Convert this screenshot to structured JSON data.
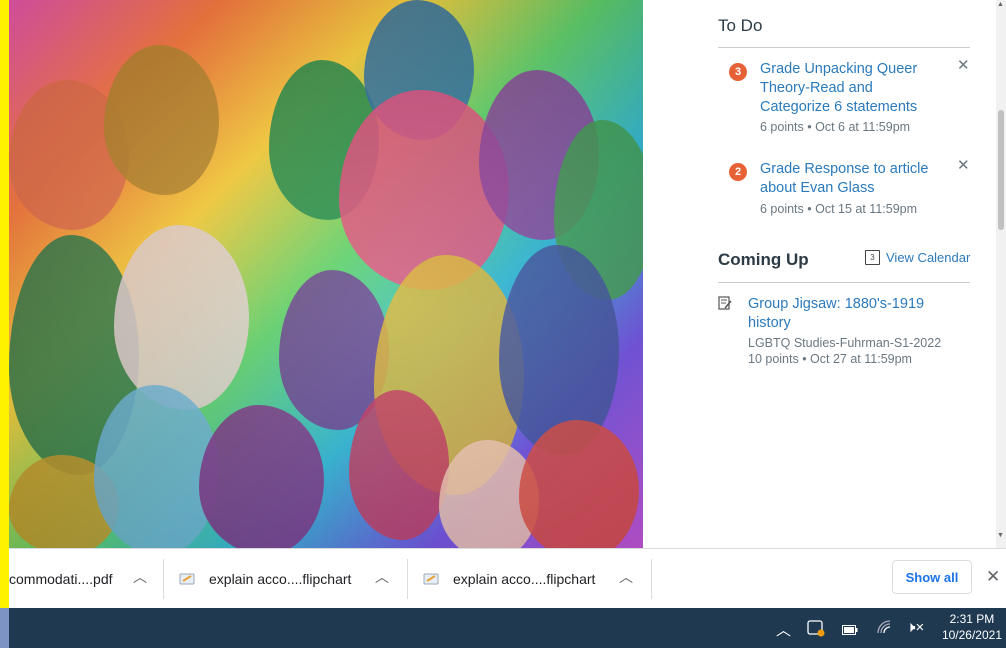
{
  "todo": {
    "heading": "To Do",
    "items": [
      {
        "badge": "3",
        "title_line1": "Grade Unpacking Queer",
        "title_line2": "Theory-Read and",
        "title_line3": "Categorize 6 statements",
        "meta": "6 points • Oct 6 at 11:59pm"
      },
      {
        "badge": "2",
        "title_line1": "Grade Response to article",
        "title_line2": "about Evan Glass",
        "meta": "6 points • Oct 15 at 11:59pm"
      }
    ]
  },
  "coming_up": {
    "heading": "Coming Up",
    "view_calendar": "View Calendar",
    "calendar_icon_digit": "3",
    "items": [
      {
        "title_line1": "Group Jigsaw: 1880's-1919",
        "title_line2": "history",
        "course": "LGBTQ Studies-Fuhrman-S1-2022",
        "meta": "10 points • Oct 27 at 11:59pm"
      }
    ]
  },
  "downloads": {
    "items": [
      {
        "name": "commodati....pdf"
      },
      {
        "name": "explain acco....flipchart"
      },
      {
        "name": "explain acco....flipchart"
      }
    ],
    "show_all": "Show all"
  },
  "taskbar": {
    "time": "2:31 PM",
    "date": "10/26/2021"
  },
  "colors": {
    "accent_link": "#2b7abc",
    "badge": "#e66135",
    "taskbar": "#1f3a50"
  }
}
